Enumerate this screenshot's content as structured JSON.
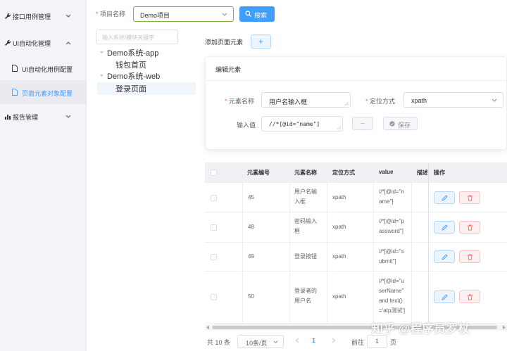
{
  "sidebar": {
    "menu_interface": "接口用例管理",
    "menu_ui": "UI自动化管理",
    "sub_case_config": "UI自动化用例配置",
    "sub_element_config": "页面元素对象配置",
    "menu_report": "报告管理"
  },
  "top": {
    "project_label": "项目名称",
    "project_value": "Demo项目",
    "search_label": "搜索"
  },
  "tree": {
    "filter_placeholder": "输入系统/模块关键字",
    "node_app": "Demo系统-app",
    "node_app_child": "钱包首页",
    "node_web": "Demo系统-web",
    "node_web_child": "登录页面"
  },
  "add": {
    "label": "添加页面元素",
    "button": "+"
  },
  "edit": {
    "title": "编辑元素",
    "name_label": "元素名称",
    "name_value": "用户名输入框",
    "locate_label": "定位方式",
    "locate_value": "xpath",
    "input_label": "输入值",
    "input_value": "//*[@id=\"name\"]",
    "dash_button": "--",
    "save_button": "保存"
  },
  "table": {
    "columns": [
      "元素编号",
      "元素名称",
      "定位方式",
      "value",
      "描述",
      "操作"
    ],
    "rows": [
      {
        "id": "45",
        "name": [
          "用户名输",
          "入框"
        ],
        "method": "xpath",
        "value": [
          "//*[@id=\"n",
          "ame\"]"
        ]
      },
      {
        "id": "48",
        "name": [
          "密码输入",
          "框"
        ],
        "method": "xpath",
        "value": [
          "//*[@id=\"p",
          "assword\"]"
        ]
      },
      {
        "id": "49",
        "name": [
          "登录按钮"
        ],
        "method": "xpath",
        "value": [
          "//*[@id=\"s",
          "ubmit\"]"
        ]
      },
      {
        "id": "50",
        "name": [
          "登录者的",
          "用户名"
        ],
        "method": "xpath",
        "value": [
          "//*[@id=\"u",
          "serName\"",
          "and text()",
          "='atp测试']"
        ]
      }
    ]
  },
  "pagination": {
    "total": "共 10 条",
    "page_size": "10条/页",
    "current": "1",
    "goto_label": "前往",
    "goto_value": "1",
    "page_unit": "页"
  },
  "watermark": "知乎 @程序员罗杖",
  "colors": {
    "primary": "#409eff",
    "danger": "#f56c6c",
    "sidebar_bg": "#f3f4f7"
  }
}
